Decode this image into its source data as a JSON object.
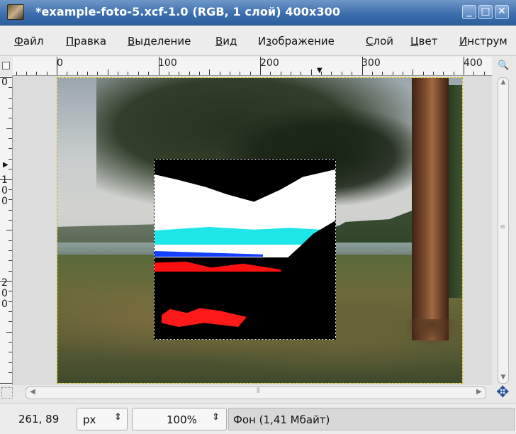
{
  "window": {
    "title": "*example-foto-5.xcf-1.0 (RGB, 1 слой) 400x300",
    "buttons": {
      "minimize": "_",
      "maximize": "□",
      "close": "✕"
    }
  },
  "menu": [
    {
      "label": "Файл",
      "underline": "Ф",
      "rest": "айл"
    },
    {
      "label": "Правка",
      "underline": "П",
      "rest": "равка"
    },
    {
      "label": "Выделение",
      "underline": "В",
      "rest": "ыделение"
    },
    {
      "label": "Вид",
      "underline": "В",
      "rest": "ид"
    },
    {
      "label": "Изображение",
      "pre": "И",
      "underline": "з",
      "rest": "ображение"
    },
    {
      "label": "Слой",
      "underline": "С",
      "rest": "лой"
    },
    {
      "label": "Цвет",
      "underline": "Ц",
      "rest": "вет"
    },
    {
      "label": "Инструм",
      "underline": "И",
      "rest": "нструм"
    }
  ],
  "ruler": {
    "h_labels": [
      "0",
      "100",
      "200",
      "300",
      "400"
    ],
    "v_labels": [
      "0",
      "100",
      "200"
    ]
  },
  "status": {
    "coords": "261, 89",
    "unit": "px",
    "zoom": "100%",
    "message": "Фон (1,41 Мбайт)",
    "spin_arrow": "⇕"
  },
  "icons": {
    "navigate": "✥",
    "zoom": "🔍"
  }
}
